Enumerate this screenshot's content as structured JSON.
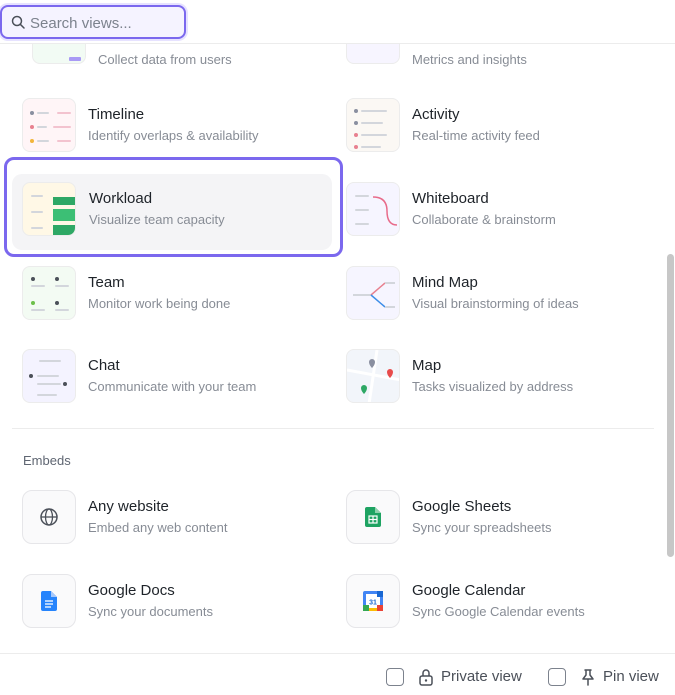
{
  "search": {
    "placeholder": "Search views...",
    "value": ""
  },
  "views": {
    "partial_left": {
      "desc": "Collect data from users"
    },
    "partial_right": {
      "desc": "Metrics and insights"
    },
    "items": [
      {
        "title": "Timeline",
        "desc": "Identify overlaps & availability"
      },
      {
        "title": "Activity",
        "desc": "Real-time activity feed"
      },
      {
        "title": "Workload",
        "desc": "Visualize team capacity"
      },
      {
        "title": "Whiteboard",
        "desc": "Collaborate & brainstorm"
      },
      {
        "title": "Team",
        "desc": "Monitor work being done"
      },
      {
        "title": "Mind Map",
        "desc": "Visual brainstorming of ideas"
      },
      {
        "title": "Chat",
        "desc": "Communicate with your team"
      },
      {
        "title": "Map",
        "desc": "Tasks visualized by address"
      }
    ]
  },
  "embeds": {
    "label": "Embeds",
    "items": [
      {
        "title": "Any website",
        "desc": "Embed any web content",
        "icon": "globe-icon"
      },
      {
        "title": "Google Sheets",
        "desc": "Sync your spreadsheets",
        "icon": "google-sheets-icon"
      },
      {
        "title": "Google Docs",
        "desc": "Sync your documents",
        "icon": "google-docs-icon"
      },
      {
        "title": "Google Calendar",
        "desc": "Sync Google Calendar events",
        "icon": "google-calendar-icon"
      }
    ]
  },
  "calendar_badge": "31",
  "footer": {
    "private_view": "Private view",
    "pin_view": "Pin view"
  },
  "colors": {
    "accent": "#7b68ee",
    "sheets": "#1ea362",
    "docs": "#2684fc",
    "calendar": "#4285f4"
  }
}
